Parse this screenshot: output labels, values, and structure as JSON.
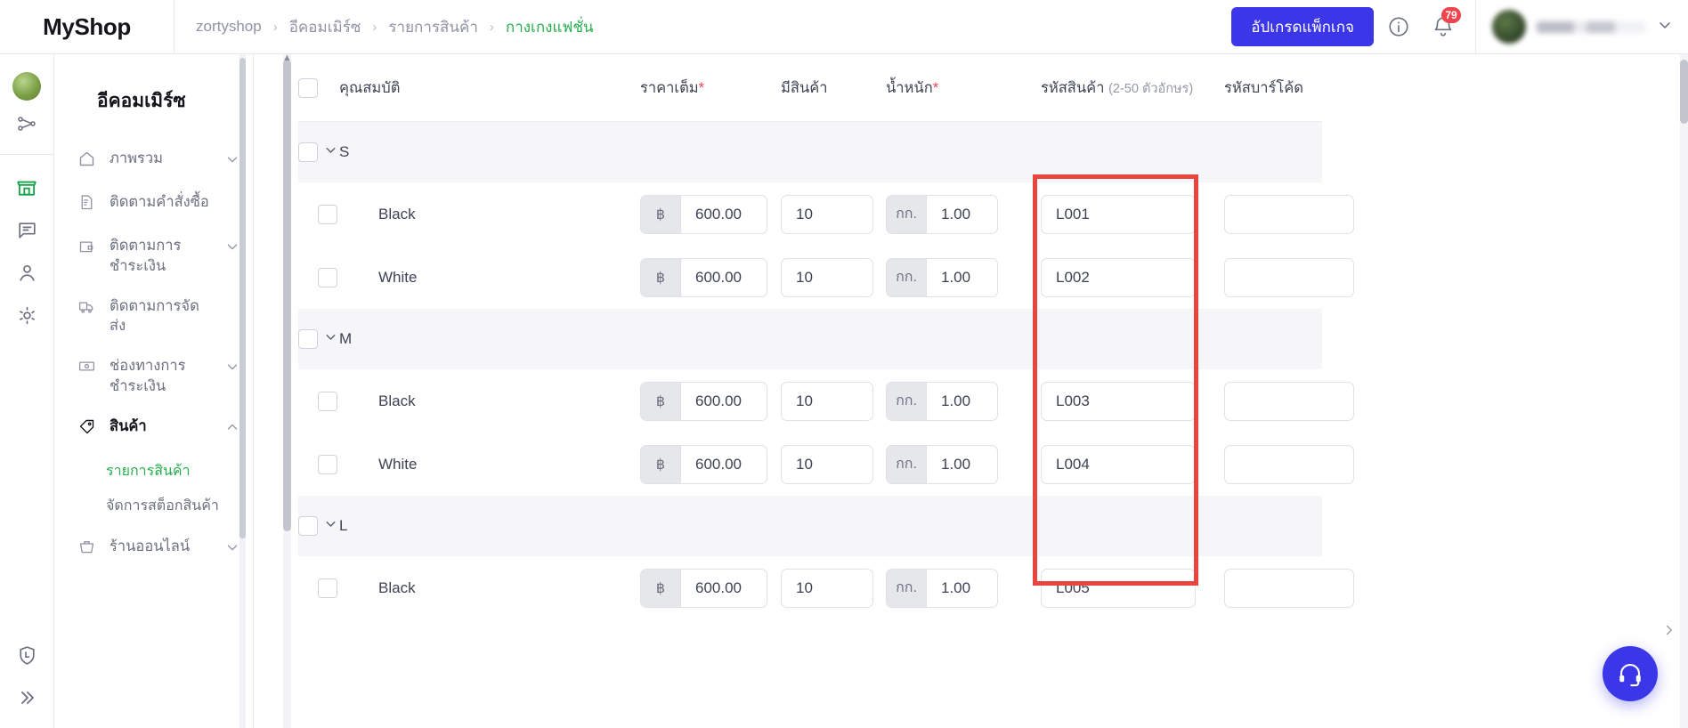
{
  "brand": {
    "name": "MyShop"
  },
  "breadcrumb": {
    "items": [
      {
        "label": "zortyshop"
      },
      {
        "label": "อีคอมเมิร์ซ"
      },
      {
        "label": "รายการสินค้า"
      },
      {
        "label": "กางเกงแฟชั่น"
      }
    ],
    "separator": "›",
    "active_color": "#27ae4e"
  },
  "topbar": {
    "upgrade_label": "อัปเกรดแพ็กเกจ",
    "upgrade_color": "#3b36e8",
    "info_icon": "info-circle-icon",
    "bell_icon": "bell-icon",
    "notification_count": "79",
    "badge_color": "#f0454e",
    "user_caret": "chevron-down-icon"
  },
  "rail": {
    "items": [
      {
        "icon": "avatar"
      },
      {
        "icon": "shuffle-icon"
      },
      {
        "icon": "store-icon",
        "active": true
      },
      {
        "icon": "chat-icon"
      },
      {
        "icon": "person-icon"
      },
      {
        "icon": "gear-icon"
      },
      {
        "icon": "shield-l-icon"
      },
      {
        "icon": "expand-right-icon"
      }
    ]
  },
  "sidebar": {
    "title": "อีคอมเมิร์ซ",
    "items": [
      {
        "label": "ภาพรวม",
        "icon": "home-icon",
        "caret": "chevron-down-icon"
      },
      {
        "label": "ติดตามคำสั่งซื้อ",
        "icon": "order-doc-icon",
        "caret": ""
      },
      {
        "label": "ติดตามการชำระเงิน",
        "icon": "wallet-icon",
        "caret": "chevron-down-icon"
      },
      {
        "label": "ติดตามการจัดส่ง",
        "icon": "truck-icon",
        "caret": ""
      },
      {
        "label": "ช่องทางการชำระเงิน",
        "icon": "banknote-icon",
        "caret": "chevron-down-icon"
      },
      {
        "label": "สินค้า",
        "icon": "tag-icon",
        "caret": "chevron-up-icon",
        "selected": true
      },
      {
        "label": "ร้านออนไลน์",
        "icon": "basket-icon",
        "caret": "chevron-down-icon"
      }
    ],
    "sub_items": [
      {
        "label": "รายการสินค้า",
        "active": true
      },
      {
        "label": "จัดการสต็อกสินค้า",
        "active": false
      }
    ]
  },
  "table": {
    "headers": {
      "attribute": "คุณสมบัติ",
      "price": "ราคาเต็ม",
      "price_required": "*",
      "stock": "มีสินค้า",
      "weight": "น้ำหนัก",
      "weight_required": "*",
      "sku": "รหัสสินค้า",
      "sku_hint": "(2-50 ตัวอักษร)",
      "barcode": "รหัสบาร์โค้ด"
    },
    "currency_addon": "฿",
    "weight_addon": "กก.",
    "groups": [
      {
        "name": "S",
        "variants": [
          {
            "name": "Black",
            "price": "600.00",
            "stock": "10",
            "weight": "1.00",
            "sku": "L001",
            "barcode": ""
          },
          {
            "name": "White",
            "price": "600.00",
            "stock": "10",
            "weight": "1.00",
            "sku": "L002",
            "barcode": ""
          }
        ]
      },
      {
        "name": "M",
        "variants": [
          {
            "name": "Black",
            "price": "600.00",
            "stock": "10",
            "weight": "1.00",
            "sku": "L003",
            "barcode": ""
          },
          {
            "name": "White",
            "price": "600.00",
            "stock": "10",
            "weight": "1.00",
            "sku": "L004",
            "barcode": ""
          }
        ]
      },
      {
        "name": "L",
        "variants": [
          {
            "name": "Black",
            "price": "600.00",
            "stock": "10",
            "weight": "1.00",
            "sku": "L005",
            "barcode": ""
          }
        ]
      }
    ]
  },
  "annotation": {
    "color": "#e8453c",
    "target": "sku-column"
  },
  "support": {
    "icon": "headset-icon",
    "color": "#3b36e8"
  }
}
